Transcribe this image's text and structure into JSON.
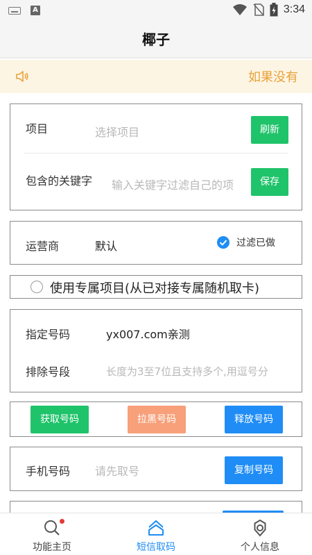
{
  "status_bar": {
    "time": "3:34"
  },
  "app_bar": {
    "title": "椰子"
  },
  "notice": {
    "text": "如果没有"
  },
  "project_card": {
    "project_label": "项目",
    "project_placeholder": "选择项目",
    "refresh_label": "刷新",
    "keyword_label": "包含的关键字",
    "keyword_placeholder": "输入关键字过滤自己的项",
    "save_label": "保存"
  },
  "carrier_card": {
    "carrier_label": "运营商",
    "carrier_value": "默认",
    "filter_label": "过滤已做",
    "filter_checked": true
  },
  "exclusive": {
    "label": "使用专属项目(从已对接专属随机取卡)",
    "checked": false
  },
  "number_card": {
    "assigned_label": "指定号码",
    "assigned_value": "yx007.com亲测",
    "exclude_label": "排除号段",
    "exclude_placeholder": "长度为3至7位且支持多个,用逗号分"
  },
  "actions": {
    "get_label": "获取号码",
    "blacklist_label": "拉黑号码",
    "release_label": "释放号码"
  },
  "phone_card": {
    "phone_label": "手机号码",
    "phone_placeholder": "请先取号",
    "copy_label": "复制号码"
  },
  "bottom_nav": {
    "items": [
      {
        "label": "功能主页"
      },
      {
        "label": "短信取码"
      },
      {
        "label": "个人信息"
      }
    ]
  },
  "colors": {
    "green": "#1fc36a",
    "orange": "#f7a07a",
    "blue": "#1f8df5",
    "notice_text": "#e8a23a",
    "notice_bg": "#fdf5e4"
  }
}
